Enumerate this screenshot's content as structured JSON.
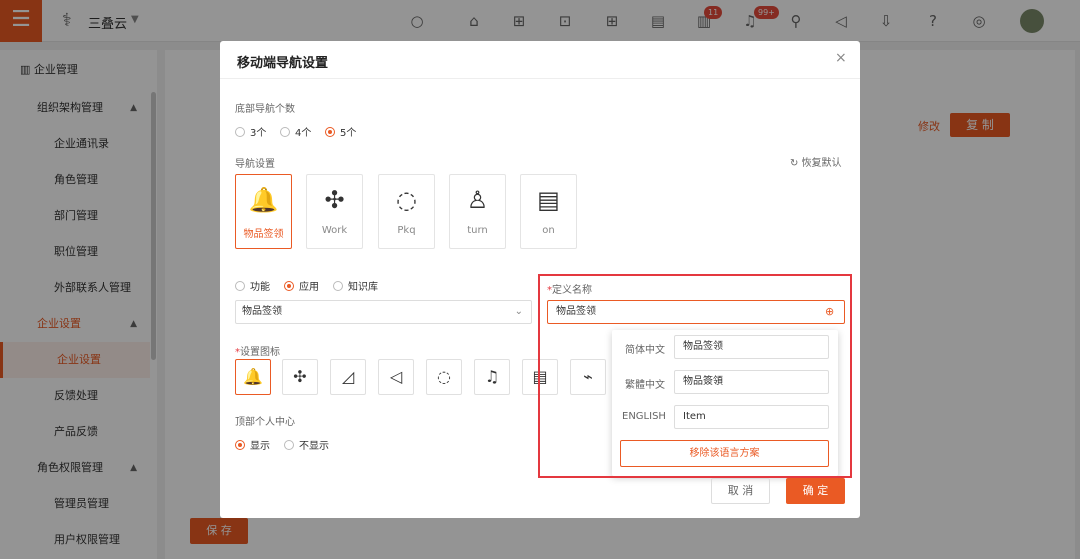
{
  "app": {
    "name": "三叠云"
  },
  "topbar": {
    "task_badge": "11",
    "notify_badge": "99+"
  },
  "sidebar": {
    "enterprise_mgmt": "企业管理",
    "org_mgmt": "组织架构管理",
    "items": [
      "企业通讯录",
      "角色管理",
      "部门管理",
      "职位管理",
      "外部联系人管理"
    ],
    "enterprise_settings": "企业设置",
    "settings_items": [
      "企业设置",
      "反馈处理",
      "产品反馈"
    ],
    "role_perm": "角色权限管理",
    "perm_items": [
      "管理员管理",
      "用户权限管理"
    ]
  },
  "background": {
    "edit": "修改",
    "copy": "复 制",
    "save": "保 存"
  },
  "modal": {
    "title": "移动端导航设置",
    "close": "×",
    "bottom_nav_count_label": "底部导航个数",
    "count_options": [
      "3个",
      "4个",
      "5个"
    ],
    "count_selected": "5个",
    "nav_settings_label": "导航设置",
    "restore_default": "恢复默认",
    "nav_items": [
      {
        "label": "物品签领",
        "icon": "bell-icon"
      },
      {
        "label": "Work",
        "icon": "apps-icon"
      },
      {
        "label": "Pkq",
        "icon": "chat-icon"
      },
      {
        "label": "turn",
        "icon": "user-icon"
      },
      {
        "label": "on",
        "icon": "document-icon"
      }
    ],
    "type_options": [
      "功能",
      "应用",
      "知识库"
    ],
    "type_selected": "应用",
    "app_select_value": "物品签领",
    "custom_name_label": "定义名称",
    "custom_name_value": "物品签领",
    "icon_label": "设置图标",
    "icons": [
      "bell-icon",
      "apps-icon",
      "chart-icon",
      "speaker-icon",
      "chat-icon",
      "bell-outline-icon",
      "document-icon",
      "line-chart-icon"
    ],
    "top_center_label": "顶部个人中心",
    "top_center_options": [
      "显示",
      "不显示"
    ],
    "top_center_selected": "显示",
    "lang_popup": {
      "rows": [
        {
          "label": "简体中文",
          "value": "物品签领"
        },
        {
          "label": "繁體中文",
          "value": "物品簽領"
        },
        {
          "label": "ENGLISH",
          "value": "Item"
        }
      ],
      "remove_button": "移除该语言方案"
    },
    "cancel": "取 消",
    "confirm": "确 定"
  }
}
